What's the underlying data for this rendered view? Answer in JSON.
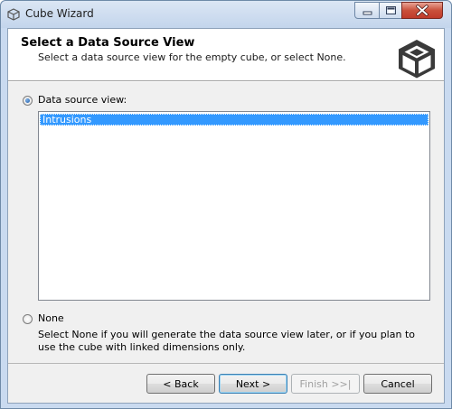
{
  "window": {
    "title": "Cube Wizard",
    "controls": {
      "minimize": "minimize",
      "maximize": "maximize",
      "close": "close"
    }
  },
  "header": {
    "title": "Select a Data Source View",
    "subtitle": "Select a data source view for the empty cube, or select None.",
    "logo_icon": "cube-icon"
  },
  "options": {
    "data_source_view": {
      "label": "Data source view:",
      "selected": true
    },
    "list": {
      "items": [
        "Intrusions"
      ],
      "selected_index": 0
    },
    "none": {
      "label": "None",
      "selected": false,
      "description": "Select None if you will generate the data source view later, or if you plan to use the cube with linked dimensions only."
    }
  },
  "buttons": {
    "back": "< Back",
    "next": "Next >",
    "finish": "Finish >>|",
    "cancel": "Cancel"
  },
  "colors": {
    "selection": "#3399ff",
    "client_bg": "#f0f0f0",
    "titlebar": "#c9daf0",
    "close_button": "#c9503b"
  }
}
